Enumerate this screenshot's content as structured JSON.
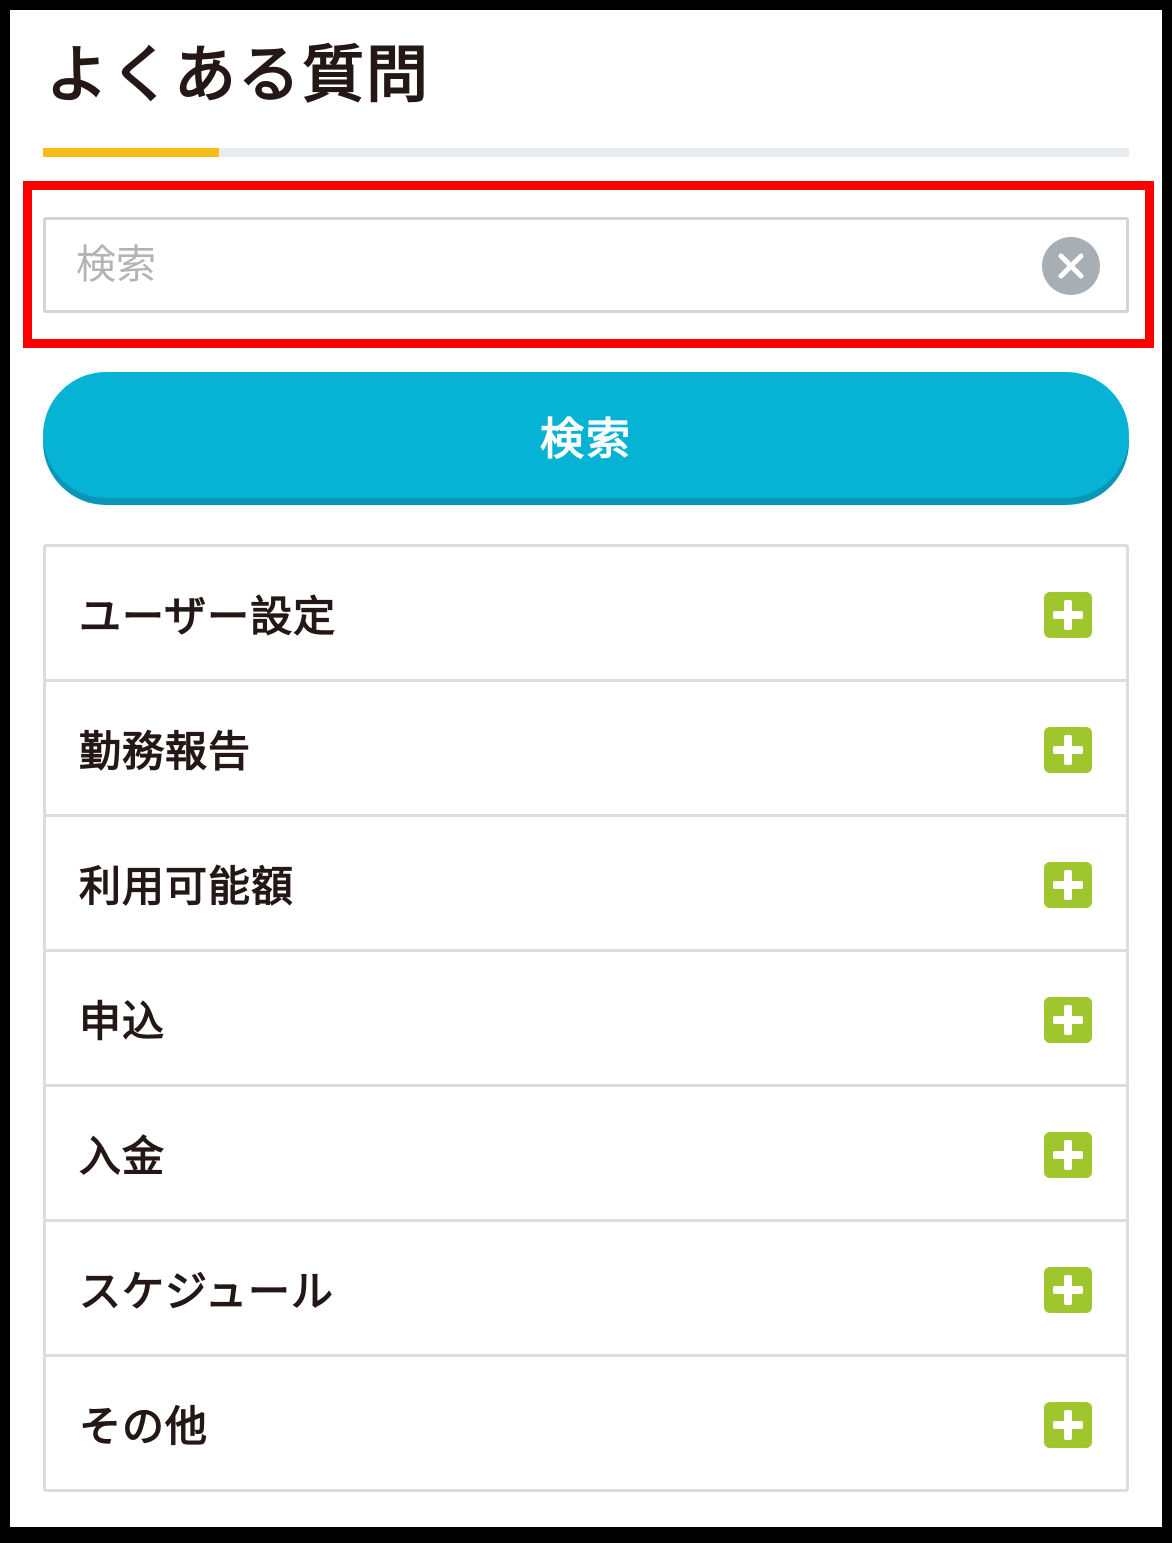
{
  "header": {
    "title": "よくある質問"
  },
  "search": {
    "placeholder": "検索",
    "value": "",
    "button_label": "検索"
  },
  "faq": {
    "categories": [
      {
        "label": "ユーザー設定"
      },
      {
        "label": "勤務報告"
      },
      {
        "label": "利用可能額"
      },
      {
        "label": "申込"
      },
      {
        "label": "入金"
      },
      {
        "label": "スケジュール"
      },
      {
        "label": "その他"
      }
    ]
  },
  "colors": {
    "accent": "#f6bd1a",
    "primary": "#06b3d4",
    "primary_dark": "#0796b5",
    "plus": "#a0c62e",
    "highlight": "#ff0000"
  },
  "icons": {
    "clear": "close-circle-icon",
    "expand": "plus-square-icon"
  }
}
